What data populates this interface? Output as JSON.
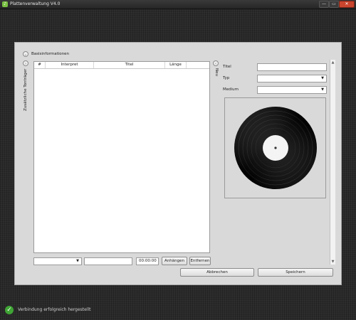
{
  "window": {
    "title": "Plattenverwaltung V4.0",
    "controls": {
      "minimize": "—",
      "maximize": "▭",
      "close": "✕"
    }
  },
  "basis": {
    "toggle_icon": "chevron-down",
    "label": "Basisinformationen",
    "side_toggle_icon": "chevron-right",
    "side_label": "Zusätzliche Tonträger"
  },
  "table": {
    "columns": [
      "#",
      "Interpret",
      "Titel",
      "Länge"
    ],
    "rows": []
  },
  "add_bar": {
    "select_value": "",
    "input_value": "",
    "time_value": "00:00:00",
    "append_label": "Anhängen",
    "remove_label": "Entfernen"
  },
  "right": {
    "collapse_icon": "chevron-left",
    "side_label": "Neu",
    "fields": {
      "title_label": "Titel",
      "title_value": "",
      "type_label": "Typ",
      "type_value": "",
      "medium_label": "Medium",
      "medium_value": ""
    },
    "cover_icon": "vinyl-record-icon"
  },
  "actions": {
    "cancel": "Abbrechen",
    "save": "Speichern"
  },
  "status": {
    "icon": "check-icon",
    "text": "Verbindung erfolgreich hergestellt"
  }
}
